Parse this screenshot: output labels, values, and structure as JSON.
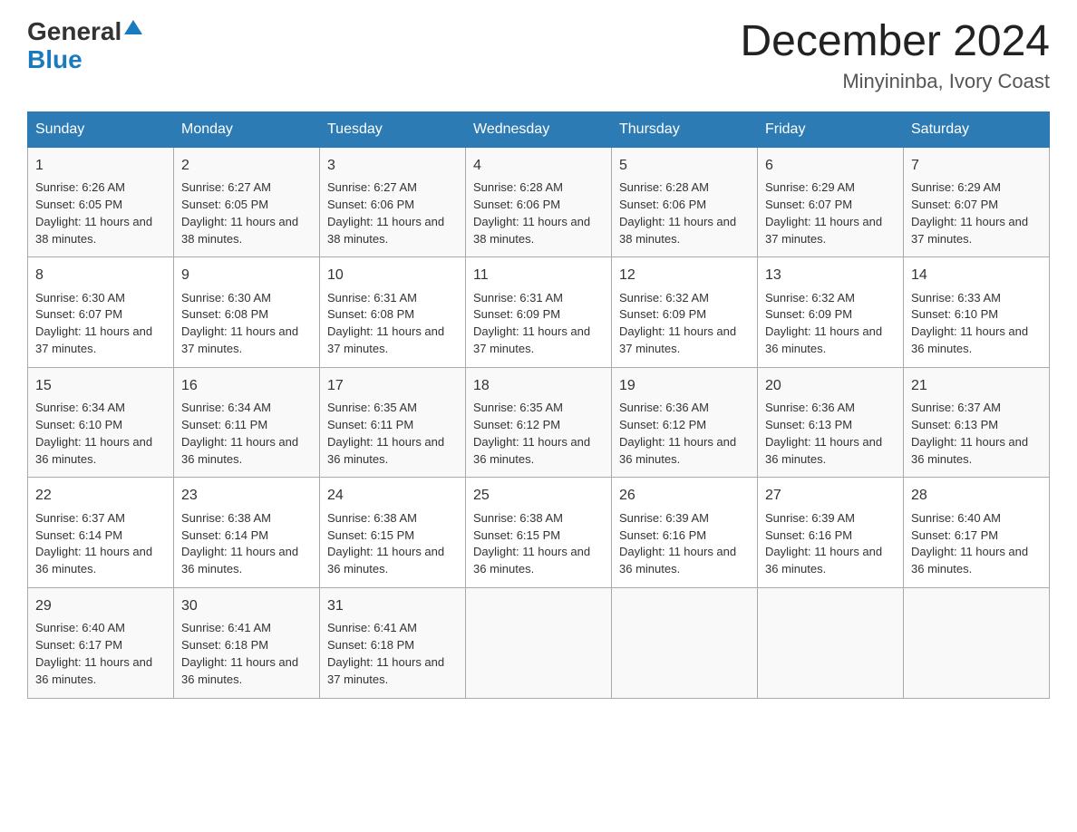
{
  "header": {
    "logo_general": "General",
    "logo_blue": "Blue",
    "month_title": "December 2024",
    "location": "Minyininba, Ivory Coast"
  },
  "days_of_week": [
    "Sunday",
    "Monday",
    "Tuesday",
    "Wednesday",
    "Thursday",
    "Friday",
    "Saturday"
  ],
  "weeks": [
    [
      {
        "day": "1",
        "sunrise": "6:26 AM",
        "sunset": "6:05 PM",
        "daylight": "11 hours and 38 minutes."
      },
      {
        "day": "2",
        "sunrise": "6:27 AM",
        "sunset": "6:05 PM",
        "daylight": "11 hours and 38 minutes."
      },
      {
        "day": "3",
        "sunrise": "6:27 AM",
        "sunset": "6:06 PM",
        "daylight": "11 hours and 38 minutes."
      },
      {
        "day": "4",
        "sunrise": "6:28 AM",
        "sunset": "6:06 PM",
        "daylight": "11 hours and 38 minutes."
      },
      {
        "day": "5",
        "sunrise": "6:28 AM",
        "sunset": "6:06 PM",
        "daylight": "11 hours and 38 minutes."
      },
      {
        "day": "6",
        "sunrise": "6:29 AM",
        "sunset": "6:07 PM",
        "daylight": "11 hours and 37 minutes."
      },
      {
        "day": "7",
        "sunrise": "6:29 AM",
        "sunset": "6:07 PM",
        "daylight": "11 hours and 37 minutes."
      }
    ],
    [
      {
        "day": "8",
        "sunrise": "6:30 AM",
        "sunset": "6:07 PM",
        "daylight": "11 hours and 37 minutes."
      },
      {
        "day": "9",
        "sunrise": "6:30 AM",
        "sunset": "6:08 PM",
        "daylight": "11 hours and 37 minutes."
      },
      {
        "day": "10",
        "sunrise": "6:31 AM",
        "sunset": "6:08 PM",
        "daylight": "11 hours and 37 minutes."
      },
      {
        "day": "11",
        "sunrise": "6:31 AM",
        "sunset": "6:09 PM",
        "daylight": "11 hours and 37 minutes."
      },
      {
        "day": "12",
        "sunrise": "6:32 AM",
        "sunset": "6:09 PM",
        "daylight": "11 hours and 37 minutes."
      },
      {
        "day": "13",
        "sunrise": "6:32 AM",
        "sunset": "6:09 PM",
        "daylight": "11 hours and 36 minutes."
      },
      {
        "day": "14",
        "sunrise": "6:33 AM",
        "sunset": "6:10 PM",
        "daylight": "11 hours and 36 minutes."
      }
    ],
    [
      {
        "day": "15",
        "sunrise": "6:34 AM",
        "sunset": "6:10 PM",
        "daylight": "11 hours and 36 minutes."
      },
      {
        "day": "16",
        "sunrise": "6:34 AM",
        "sunset": "6:11 PM",
        "daylight": "11 hours and 36 minutes."
      },
      {
        "day": "17",
        "sunrise": "6:35 AM",
        "sunset": "6:11 PM",
        "daylight": "11 hours and 36 minutes."
      },
      {
        "day": "18",
        "sunrise": "6:35 AM",
        "sunset": "6:12 PM",
        "daylight": "11 hours and 36 minutes."
      },
      {
        "day": "19",
        "sunrise": "6:36 AM",
        "sunset": "6:12 PM",
        "daylight": "11 hours and 36 minutes."
      },
      {
        "day": "20",
        "sunrise": "6:36 AM",
        "sunset": "6:13 PM",
        "daylight": "11 hours and 36 minutes."
      },
      {
        "day": "21",
        "sunrise": "6:37 AM",
        "sunset": "6:13 PM",
        "daylight": "11 hours and 36 minutes."
      }
    ],
    [
      {
        "day": "22",
        "sunrise": "6:37 AM",
        "sunset": "6:14 PM",
        "daylight": "11 hours and 36 minutes."
      },
      {
        "day": "23",
        "sunrise": "6:38 AM",
        "sunset": "6:14 PM",
        "daylight": "11 hours and 36 minutes."
      },
      {
        "day": "24",
        "sunrise": "6:38 AM",
        "sunset": "6:15 PM",
        "daylight": "11 hours and 36 minutes."
      },
      {
        "day": "25",
        "sunrise": "6:38 AM",
        "sunset": "6:15 PM",
        "daylight": "11 hours and 36 minutes."
      },
      {
        "day": "26",
        "sunrise": "6:39 AM",
        "sunset": "6:16 PM",
        "daylight": "11 hours and 36 minutes."
      },
      {
        "day": "27",
        "sunrise": "6:39 AM",
        "sunset": "6:16 PM",
        "daylight": "11 hours and 36 minutes."
      },
      {
        "day": "28",
        "sunrise": "6:40 AM",
        "sunset": "6:17 PM",
        "daylight": "11 hours and 36 minutes."
      }
    ],
    [
      {
        "day": "29",
        "sunrise": "6:40 AM",
        "sunset": "6:17 PM",
        "daylight": "11 hours and 36 minutes."
      },
      {
        "day": "30",
        "sunrise": "6:41 AM",
        "sunset": "6:18 PM",
        "daylight": "11 hours and 36 minutes."
      },
      {
        "day": "31",
        "sunrise": "6:41 AM",
        "sunset": "6:18 PM",
        "daylight": "11 hours and 37 minutes."
      },
      null,
      null,
      null,
      null
    ]
  ],
  "labels": {
    "sunrise": "Sunrise:",
    "sunset": "Sunset:",
    "daylight": "Daylight:"
  }
}
